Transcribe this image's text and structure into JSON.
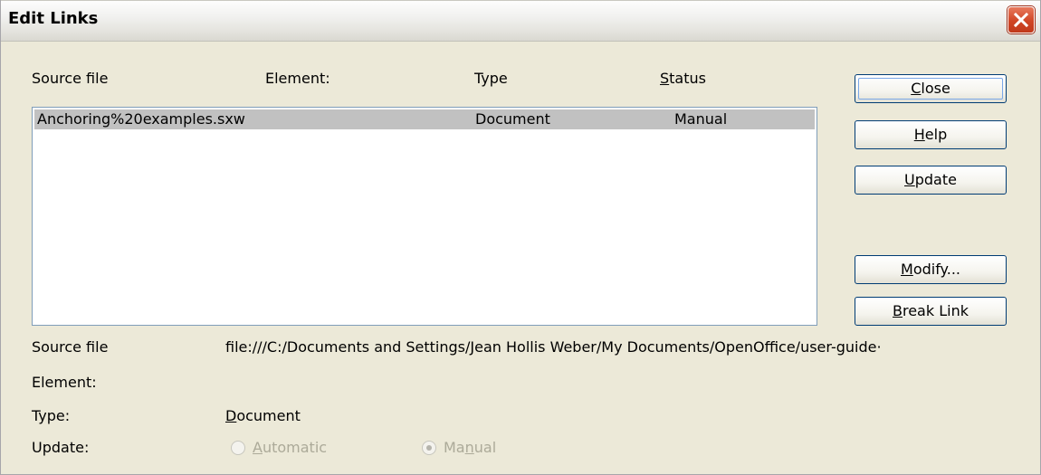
{
  "window": {
    "title": "Edit Links"
  },
  "columns": {
    "source_file": "Source file",
    "element": "Element:",
    "type": "Type",
    "status": "Status"
  },
  "links": [
    {
      "source_file": "Anchoring%20examples.sxw",
      "element": "",
      "type": "Document",
      "status": "Manual"
    }
  ],
  "buttons": {
    "close": "Close",
    "help": "Help",
    "update": "Update",
    "modify": "Modify...",
    "break_link": "Break Link"
  },
  "details": {
    "source_file_label": "Source file",
    "source_file_value": "file:///C:/Documents and Settings/Jean Hollis Weber/My Documents/OpenOffice/user-guide·",
    "element_label": "Element:",
    "element_value": "",
    "type_label": "Type:",
    "type_value": "Document",
    "update_label": "Update:",
    "update_options": [
      {
        "label": "Automatic",
        "selected": false,
        "enabled": false
      },
      {
        "label": "Manual",
        "selected": true,
        "enabled": false
      }
    ]
  },
  "colors": {
    "selection_row": "#c1c1c1",
    "dialog_bg": "#ece9d8",
    "close_button_red": "#d04525"
  }
}
